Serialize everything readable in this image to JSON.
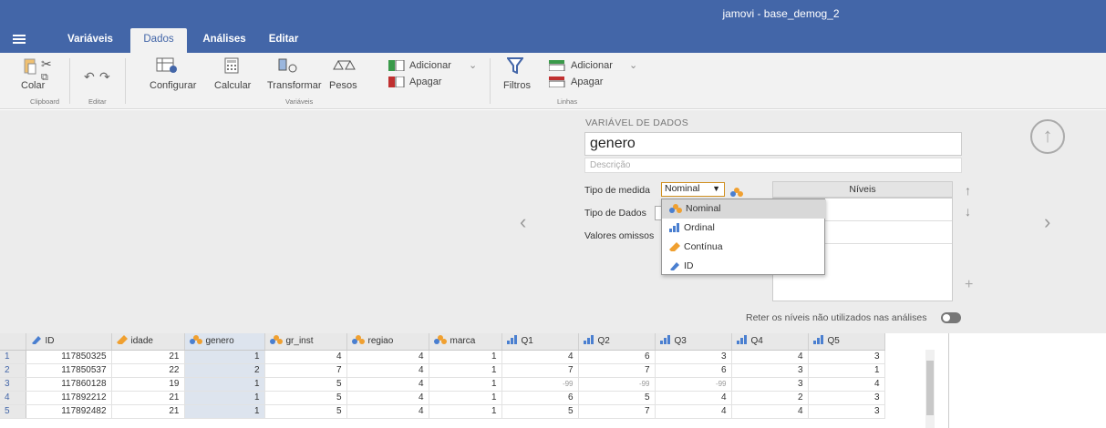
{
  "title": "jamovi - base_demog_2",
  "tabs": [
    "Variáveis",
    "Dados",
    "Análises",
    "Editar"
  ],
  "ribbon": {
    "colar": "Colar",
    "clipboard": "Clipboard",
    "editar": "Editar",
    "configurar": "Configurar",
    "calcular": "Calcular",
    "transformar": "Transformar",
    "pesos": "Pesos",
    "variaveis": "Variáveis",
    "adicionar_var": "Adicionar",
    "apagar_var": "Apagar",
    "filtros": "Filtros",
    "adicionar_lin": "Adicionar",
    "apagar_lin": "Apagar",
    "linhas": "Linhas"
  },
  "editor": {
    "header": "VARIÁVEL DE DADOS",
    "name": "genero",
    "description_placeholder": "Descrição",
    "measure_label": "Tipo de medida",
    "measure_value": "Nominal",
    "data_type_label": "Tipo de Dados",
    "missing_label": "Valores omissos",
    "levels_header": "Níveis",
    "retain_label": "Reter os níveis não utilizados nas análises",
    "measure_options": [
      "Nominal",
      "Ordinal",
      "Contínua",
      "ID"
    ]
  },
  "grid": {
    "columns": [
      "ID",
      "idade",
      "genero",
      "gr_inst",
      "regiao",
      "marca",
      "Q1",
      "Q2",
      "Q3",
      "Q4",
      "Q5"
    ],
    "col_types": [
      "id",
      "cont",
      "nom",
      "nom",
      "nom",
      "nom",
      "ord",
      "ord",
      "ord",
      "ord",
      "ord"
    ],
    "rows": [
      [
        "1",
        "117850325",
        "21",
        "1",
        "4",
        "4",
        "1",
        "4",
        "6",
        "3",
        "4",
        "3"
      ],
      [
        "2",
        "117850537",
        "22",
        "2",
        "7",
        "4",
        "1",
        "7",
        "7",
        "6",
        "3",
        "1"
      ],
      [
        "3",
        "117860128",
        "19",
        "1",
        "5",
        "4",
        "1",
        "-99",
        "-99",
        "-99",
        "3",
        "4"
      ],
      [
        "4",
        "117892212",
        "21",
        "1",
        "5",
        "4",
        "1",
        "6",
        "5",
        "4",
        "2",
        "3"
      ],
      [
        "5",
        "117892482",
        "21",
        "1",
        "5",
        "4",
        "1",
        "5",
        "7",
        "4",
        "4",
        "3"
      ]
    ]
  },
  "colors": {
    "accent": "#4366a8",
    "nominal_orange": "#f0a030",
    "nominal_blue": "#4a7fd0"
  }
}
